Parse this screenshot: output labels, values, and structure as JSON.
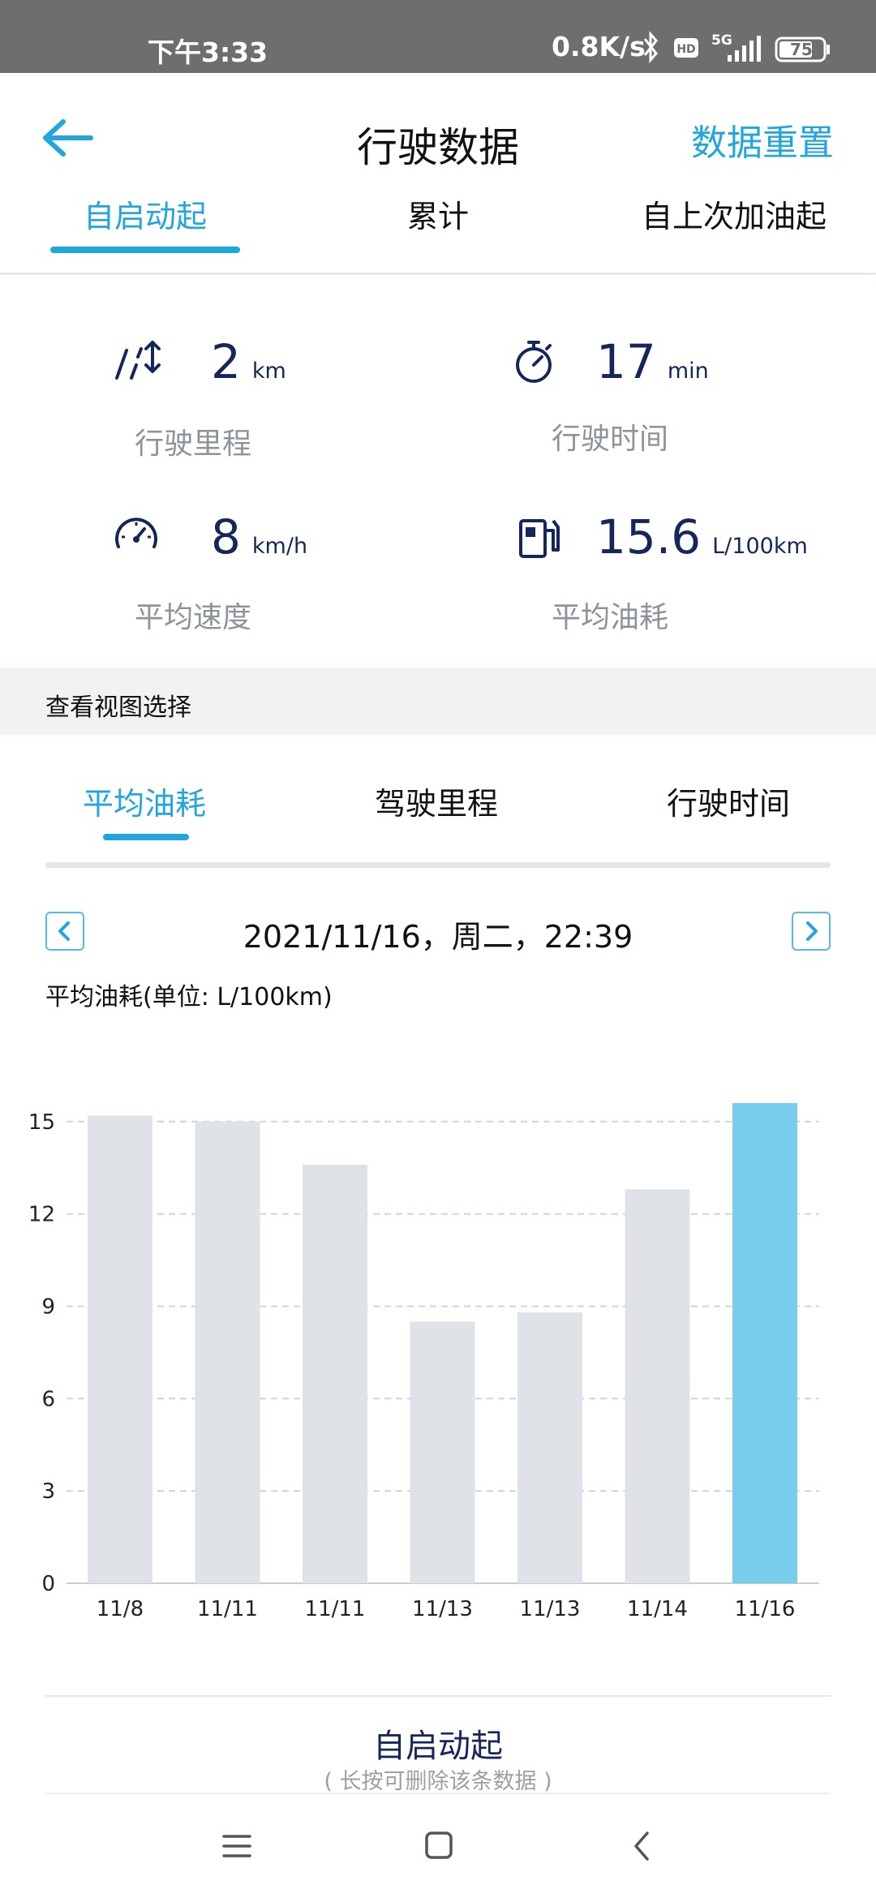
{
  "status_bar": {
    "time": "下午3:33",
    "network_speed": "0.8K/s",
    "signal": "5G",
    "battery": "75",
    "icons": [
      "bluetooth-icon",
      "hd-icon",
      "signal-icon",
      "battery-icon"
    ]
  },
  "header": {
    "title": "行驶数据",
    "reset_label": "数据重置",
    "back_icon": "arrow-left-icon",
    "tabs": [
      {
        "label": "自启动起",
        "active": true
      },
      {
        "label": "累计",
        "active": false
      },
      {
        "label": "自上次加油起",
        "active": false
      }
    ]
  },
  "stats": {
    "distance": {
      "value": "2",
      "unit": "km",
      "label": "行驶里程",
      "icon": "road-icon"
    },
    "time": {
      "value": "17",
      "unit": "min",
      "label": "行驶时间",
      "icon": "stopwatch-icon"
    },
    "speed": {
      "value": "8",
      "unit": "km/h",
      "label": "平均速度",
      "icon": "speedometer-icon"
    },
    "fuel": {
      "value": "15.6",
      "unit": "L/100km",
      "label": "平均油耗",
      "icon": "fuel-pump-icon"
    }
  },
  "view_select": {
    "label": "查看视图选择",
    "tabs": [
      {
        "label": "平均油耗",
        "active": true
      },
      {
        "label": "驾驶里程",
        "active": false
      },
      {
        "label": "行驶时间",
        "active": false
      }
    ]
  },
  "date_nav": {
    "date": "2021/11/16，周二，22:39"
  },
  "chart_title": "平均油耗(单位: L/100km)",
  "chart_data": {
    "type": "bar",
    "categories": [
      "11/8",
      "11/11",
      "11/11",
      "11/13",
      "11/13",
      "11/14",
      "11/16"
    ],
    "values": [
      15.2,
      15.0,
      13.6,
      8.5,
      8.8,
      12.8,
      15.6
    ],
    "highlight_index": 6,
    "ylim": [
      0,
      15.6
    ],
    "yticks": [
      0,
      3,
      6,
      9,
      12,
      15
    ],
    "grid": true,
    "colors": {
      "bar": "#dfe3e7",
      "highlight": "#79cdec",
      "grid": "#cfd4d8"
    }
  },
  "footer": {
    "title": "自启动起",
    "hint": "( 长按可删除该条数据 )"
  },
  "colors": {
    "accent": "#20a6dc",
    "navy": "#15275a"
  }
}
